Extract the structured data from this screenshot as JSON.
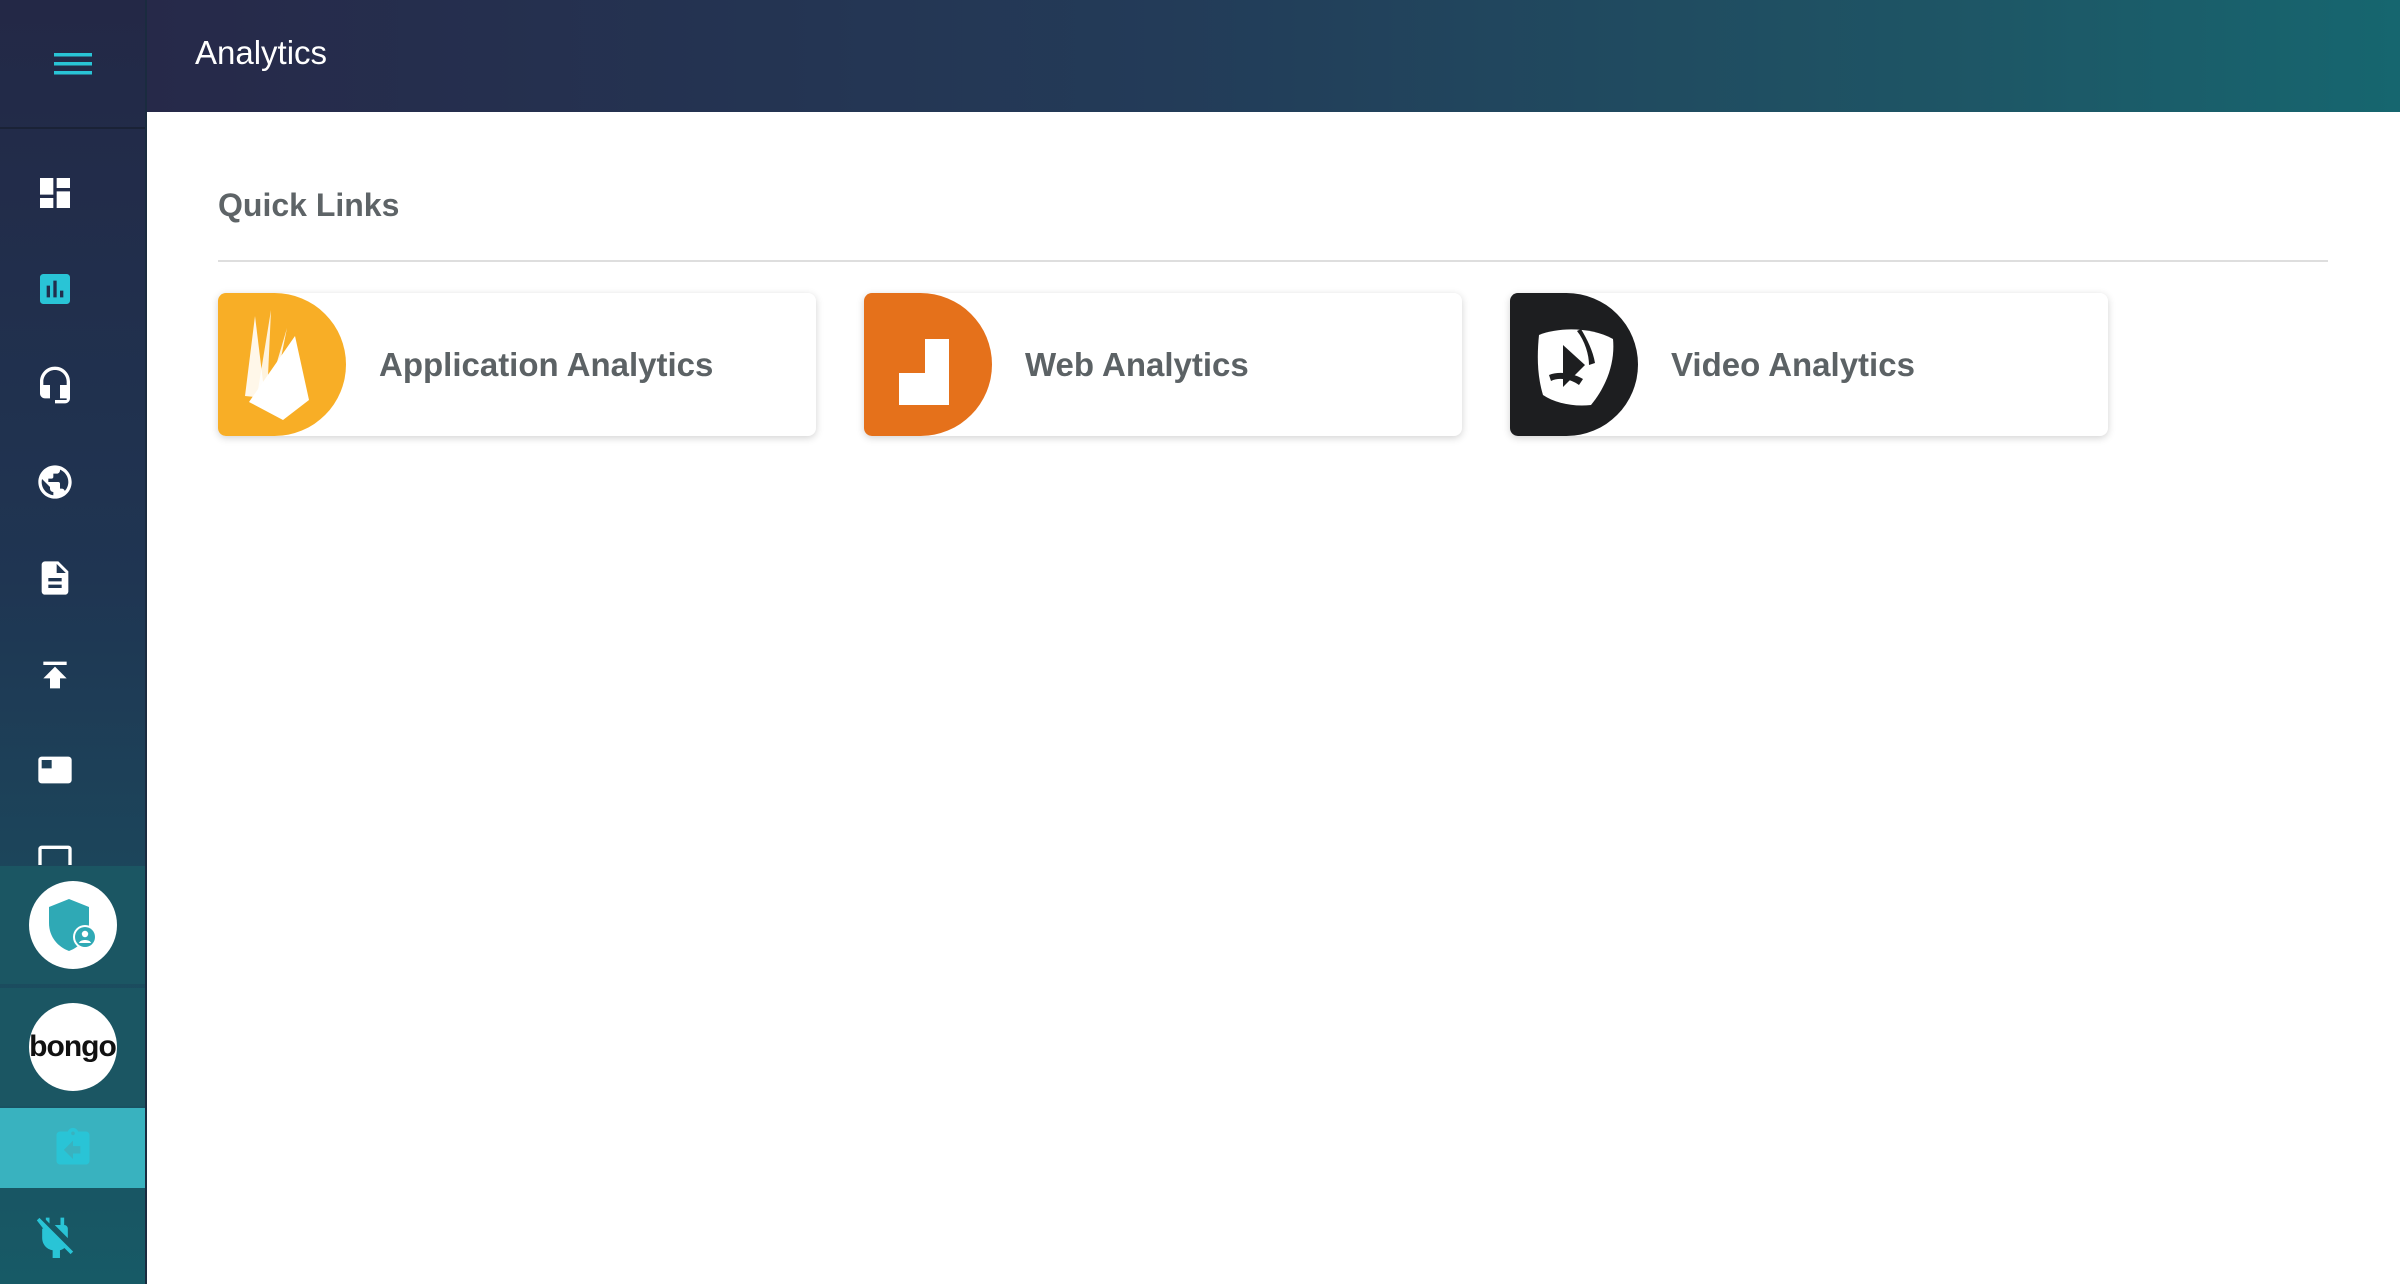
{
  "header": {
    "title": "Analytics"
  },
  "sidebar": {
    "items": [
      {
        "name": "dashboard",
        "icon": "dashboard-icon"
      },
      {
        "name": "analytics",
        "icon": "bar-chart-icon",
        "active": true
      },
      {
        "name": "support",
        "icon": "headset-icon"
      },
      {
        "name": "web",
        "icon": "globe-icon"
      },
      {
        "name": "documents",
        "icon": "document-icon"
      },
      {
        "name": "upload",
        "icon": "upload-icon"
      },
      {
        "name": "media",
        "icon": "media-icon"
      },
      {
        "name": "screen",
        "icon": "screen-icon"
      }
    ],
    "profile_icon": "admin-shield-icon",
    "brand": {
      "b": "bongo",
      "tail": ""
    },
    "back_icon": "back-clipboard-icon",
    "plugin_icon": "plugin-off-icon"
  },
  "main": {
    "section_title": "Quick Links",
    "cards": [
      {
        "label": "Application Analytics",
        "icon": "firebase-icon",
        "color": "#f8ae26"
      },
      {
        "label": "Web Analytics",
        "icon": "matomo-icon",
        "color": "#e5711b"
      },
      {
        "label": "Video Analytics",
        "icon": "video-analytics-icon",
        "color": "#1d1e20"
      }
    ]
  },
  "colors": {
    "accent": "#29c4d6",
    "active_bg": "#39b2bf",
    "header_start": "#262949",
    "header_end": "#16666f"
  }
}
